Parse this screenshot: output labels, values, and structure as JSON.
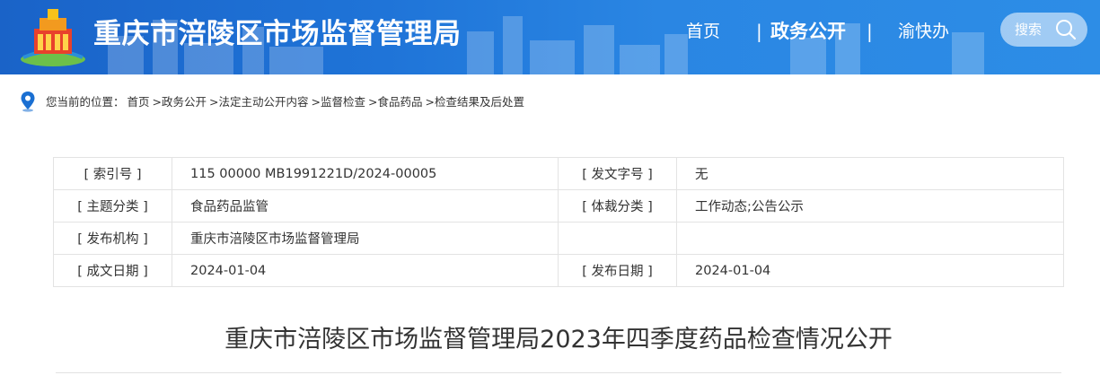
{
  "header": {
    "site_title": "重庆市涪陵区市场监督管理局",
    "nav": {
      "home": "首页",
      "separator": "|",
      "gov_affairs": "政务公开",
      "yu_kuai_ban": "渝快办"
    },
    "search_label": "搜索"
  },
  "breadcrumb": {
    "prefix": "您当前的位置：",
    "items": [
      "首页",
      ">政务公开",
      ">法定主动公开内容",
      ">监督检查",
      ">食品药品",
      ">检查结果及后处置"
    ]
  },
  "info_table": {
    "rows": [
      {
        "label1": "[ 索引号 ]",
        "value1": "115 00000 MB1991221D/2024-00005",
        "label2": "[ 发文字号 ]",
        "value2": "无"
      },
      {
        "label1": "[ 主题分类 ]",
        "value1": "食品药品监管",
        "label2": "[ 体裁分类 ]",
        "value2": "工作动态;公告公示"
      },
      {
        "label1": "[ 发布机构 ]",
        "value1": "重庆市涪陵区市场监督管理局",
        "label2": "",
        "value2": ""
      },
      {
        "label1": "[ 成文日期 ]",
        "value1": "2024-01-04",
        "label2": "[ 发布日期 ]",
        "value2": "2024-01-04"
      }
    ]
  },
  "article": {
    "title": "重庆市涪陵区市场监督管理局2023年四季度药品检查情况公开"
  },
  "colors": {
    "header_blue": "#1f74d8",
    "border": "#e3e3e3",
    "pin_blue": "#1a6fd2"
  },
  "icons": {
    "logo": "emblem-logo",
    "search": "search-icon",
    "location": "location-pin-icon"
  }
}
